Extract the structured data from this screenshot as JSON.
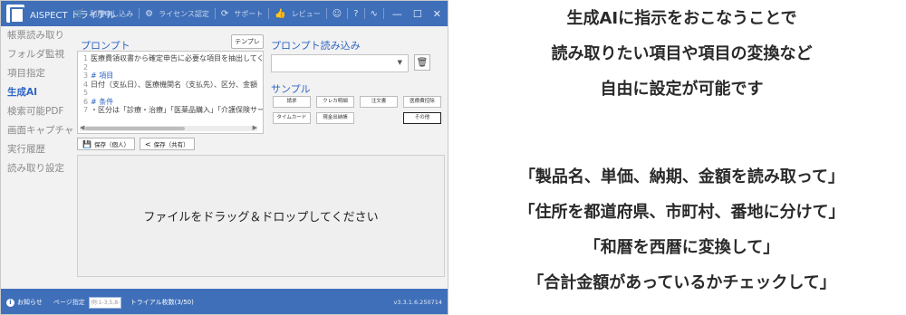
{
  "app": {
    "title": "AISPECT トライアル",
    "toolbar": {
      "apply": "利用申し込み",
      "license": "ライセンス認定",
      "support": "サポート",
      "review": "レビュー"
    }
  },
  "sidebar": {
    "items": [
      {
        "label": "帳票読み取り",
        "active": false
      },
      {
        "label": "フォルダ監視",
        "active": false
      },
      {
        "label": "項目指定",
        "active": false
      },
      {
        "label": "生成AI",
        "active": true
      },
      {
        "label": "検索可能PDF",
        "active": false
      },
      {
        "label": "画面キャプチャ",
        "active": false
      },
      {
        "label": "実行履歴",
        "active": false
      },
      {
        "label": "読み取り設定",
        "active": false
      }
    ]
  },
  "prompt": {
    "label": "プロンプト",
    "template_button": "テンプレート",
    "lines": [
      {
        "num": "1",
        "text": "医療費領収書から確定申告に必要な項目を抽出してくた"
      },
      {
        "num": "2",
        "text": ""
      },
      {
        "num": "3",
        "text": "# 項目"
      },
      {
        "num": "4",
        "text": "日付（支払日）、医療機関名（支払先）、区分、金額"
      },
      {
        "num": "5",
        "text": ""
      },
      {
        "num": "6",
        "text": "# 条件"
      },
      {
        "num": "7",
        "text": "・区分は「診療・治療」「医薬品購入」「介護保険サービス」"
      }
    ],
    "save_personal": "保存（個人）",
    "save_shared": "保存（共有）"
  },
  "prompt_load": {
    "label": "プロンプト読み込み",
    "selected": ""
  },
  "samples": {
    "label": "サンプル",
    "buttons": [
      "請求",
      "クレカ明細",
      "注文書",
      "医療費控除",
      "タイムカード",
      "現金出納帳",
      "その他"
    ],
    "selected_index": 6
  },
  "dropzone": {
    "text": "ファイルをドラッグ＆ドロップしてください"
  },
  "status": {
    "notice": "お知らせ",
    "page_label": "ページ指定",
    "page_placeholder": "例:1-3,5,8-",
    "trial": "トライアル枚数(3/50)",
    "version": "v3.3.1.6.250714"
  },
  "caption": {
    "line1": "生成AIに指示をおこなうことで",
    "line2": "読み取りたい項目や項目の変換など",
    "line3": "自由に設定が可能です",
    "example1": "「製品名、単価、納期、金額を読み取って」",
    "example2": "「住所を都道府県、市町村、番地に分けて」",
    "example3": "「和暦を西暦に変換して」",
    "example4": "「合計金額があっているかチェックして」"
  },
  "colors": {
    "accent": "#3f6fb8",
    "active_nav": "#2f66c4"
  },
  "icons": [
    "app-icon",
    "cart-icon",
    "gear-icon",
    "support-icon",
    "thumbs-up-icon",
    "smile-icon",
    "help-icon",
    "minimize-icon",
    "maximize-icon",
    "close-icon",
    "trash-icon",
    "save-icon",
    "share-icon",
    "info-icon"
  ]
}
